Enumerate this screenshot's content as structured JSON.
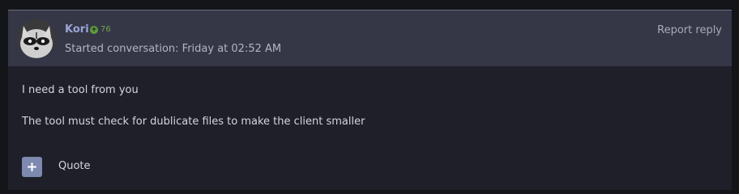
{
  "post": {
    "username": "Kori",
    "reputation": "76",
    "started": "Started conversation: Friday at 02:52 AM",
    "report_label": "Report reply",
    "messages": [
      "I need a tool from you",
      "The tool must check for dublicate files to make the client smaller"
    ],
    "quote_label": "Quote"
  },
  "icons": {
    "reputation": "plus-circle-icon",
    "quote": "plus-icon",
    "avatar": "raccoon-avatar"
  },
  "colors": {
    "username": "#9aa5d6",
    "reputation": "#5f9e3c",
    "header_bg": "#353747",
    "body_bg": "#1e1f28",
    "quote_button": "#7e89b0"
  }
}
